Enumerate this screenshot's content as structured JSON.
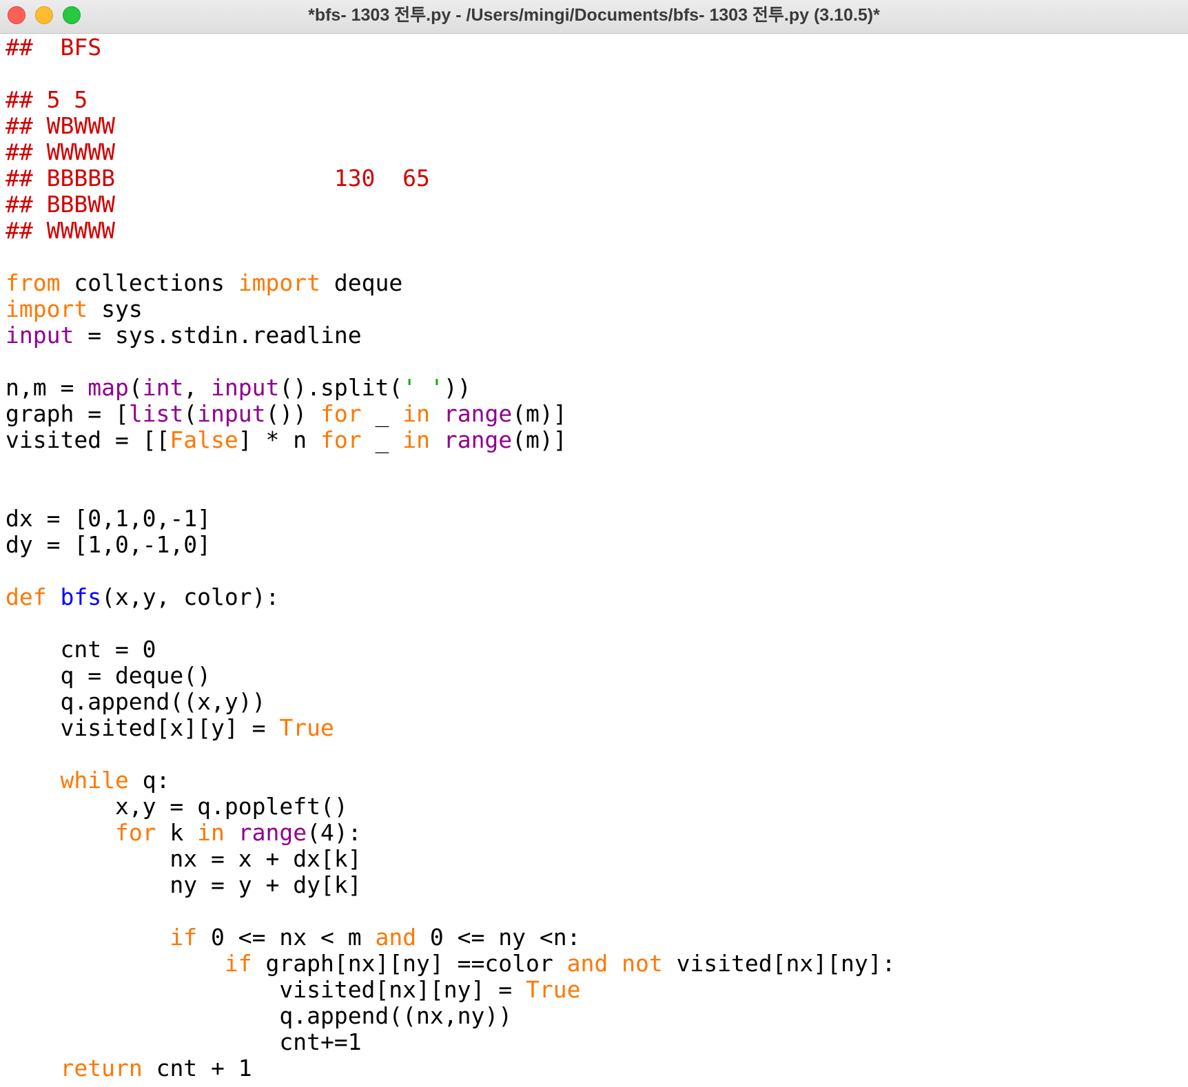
{
  "window": {
    "title": "*bfs- 1303 전투.py - /Users/mingi/Documents/bfs- 1303 전투.py (3.10.5)*"
  },
  "colors": {
    "comment": "#d10000",
    "keyword": "#ff7700",
    "builtin": "#900090",
    "definition": "#0000ff",
    "string": "#00aa00",
    "default": "#000000"
  },
  "code": {
    "lines": [
      [
        {
          "t": "##  BFS",
          "c": "cm"
        }
      ],
      [],
      [
        {
          "t": "## 5 5",
          "c": "cm"
        }
      ],
      [
        {
          "t": "## WBWWW",
          "c": "cm"
        }
      ],
      [
        {
          "t": "## WWWWW",
          "c": "cm"
        }
      ],
      [
        {
          "t": "## BBBBB                130  65",
          "c": "cm"
        }
      ],
      [
        {
          "t": "## BBBWW",
          "c": "cm"
        }
      ],
      [
        {
          "t": "## WWWWW",
          "c": "cm"
        }
      ],
      [],
      [
        {
          "t": "from",
          "c": "kw"
        },
        {
          "t": " collections "
        },
        {
          "t": "import",
          "c": "kw"
        },
        {
          "t": " deque"
        }
      ],
      [
        {
          "t": "import",
          "c": "kw"
        },
        {
          "t": " sys"
        }
      ],
      [
        {
          "t": "input",
          "c": "bi"
        },
        {
          "t": " = sys.stdin.readline"
        }
      ],
      [],
      [
        {
          "t": "n,m = "
        },
        {
          "t": "map",
          "c": "bi"
        },
        {
          "t": "("
        },
        {
          "t": "int",
          "c": "bi"
        },
        {
          "t": ", "
        },
        {
          "t": "input",
          "c": "bi"
        },
        {
          "t": "().split("
        },
        {
          "t": "' '",
          "c": "st"
        },
        {
          "t": "))"
        }
      ],
      [
        {
          "t": "graph = ["
        },
        {
          "t": "list",
          "c": "bi"
        },
        {
          "t": "("
        },
        {
          "t": "input",
          "c": "bi"
        },
        {
          "t": "()) "
        },
        {
          "t": "for",
          "c": "kw"
        },
        {
          "t": " _ "
        },
        {
          "t": "in",
          "c": "kw"
        },
        {
          "t": " "
        },
        {
          "t": "range",
          "c": "bi"
        },
        {
          "t": "(m)]"
        }
      ],
      [
        {
          "t": "visited = [["
        },
        {
          "t": "False",
          "c": "kw"
        },
        {
          "t": "] * n "
        },
        {
          "t": "for",
          "c": "kw"
        },
        {
          "t": " _ "
        },
        {
          "t": "in",
          "c": "kw"
        },
        {
          "t": " "
        },
        {
          "t": "range",
          "c": "bi"
        },
        {
          "t": "(m)]"
        }
      ],
      [],
      [],
      [
        {
          "t": "dx = [0,1,0,-1]"
        }
      ],
      [
        {
          "t": "dy = [1,0,-1,0]"
        }
      ],
      [],
      [
        {
          "t": "def",
          "c": "kw"
        },
        {
          "t": " "
        },
        {
          "t": "bfs",
          "c": "df"
        },
        {
          "t": "(x,y, color):"
        }
      ],
      [],
      [
        {
          "t": "    cnt = 0"
        }
      ],
      [
        {
          "t": "    q = deque()"
        }
      ],
      [
        {
          "t": "    q.append((x,y))"
        }
      ],
      [
        {
          "t": "    visited[x][y] = "
        },
        {
          "t": "True",
          "c": "kw"
        }
      ],
      [],
      [
        {
          "t": "    "
        },
        {
          "t": "while",
          "c": "kw"
        },
        {
          "t": " q:"
        }
      ],
      [
        {
          "t": "        x,y = q.popleft()"
        }
      ],
      [
        {
          "t": "        "
        },
        {
          "t": "for",
          "c": "kw"
        },
        {
          "t": " k "
        },
        {
          "t": "in",
          "c": "kw"
        },
        {
          "t": " "
        },
        {
          "t": "range",
          "c": "bi"
        },
        {
          "t": "(4):"
        }
      ],
      [
        {
          "t": "            nx = x + dx[k]"
        }
      ],
      [
        {
          "t": "            ny = y + dy[k]"
        }
      ],
      [],
      [
        {
          "t": "            "
        },
        {
          "t": "if",
          "c": "kw"
        },
        {
          "t": " 0 <= nx < m "
        },
        {
          "t": "and",
          "c": "kw"
        },
        {
          "t": " 0 <= ny <n:"
        }
      ],
      [
        {
          "t": "                "
        },
        {
          "t": "if",
          "c": "kw"
        },
        {
          "t": " graph[nx][ny] ==color "
        },
        {
          "t": "and",
          "c": "kw"
        },
        {
          "t": " "
        },
        {
          "t": "not",
          "c": "kw"
        },
        {
          "t": " visited[nx][ny]:"
        }
      ],
      [
        {
          "t": "                    visited[nx][ny] = "
        },
        {
          "t": "True",
          "c": "kw"
        }
      ],
      [
        {
          "t": "                    q.append((nx,ny))"
        }
      ],
      [
        {
          "t": "                    cnt+=1"
        }
      ],
      [
        {
          "t": "    "
        },
        {
          "t": "return",
          "c": "kw"
        },
        {
          "t": " cnt + 1"
        }
      ]
    ]
  }
}
